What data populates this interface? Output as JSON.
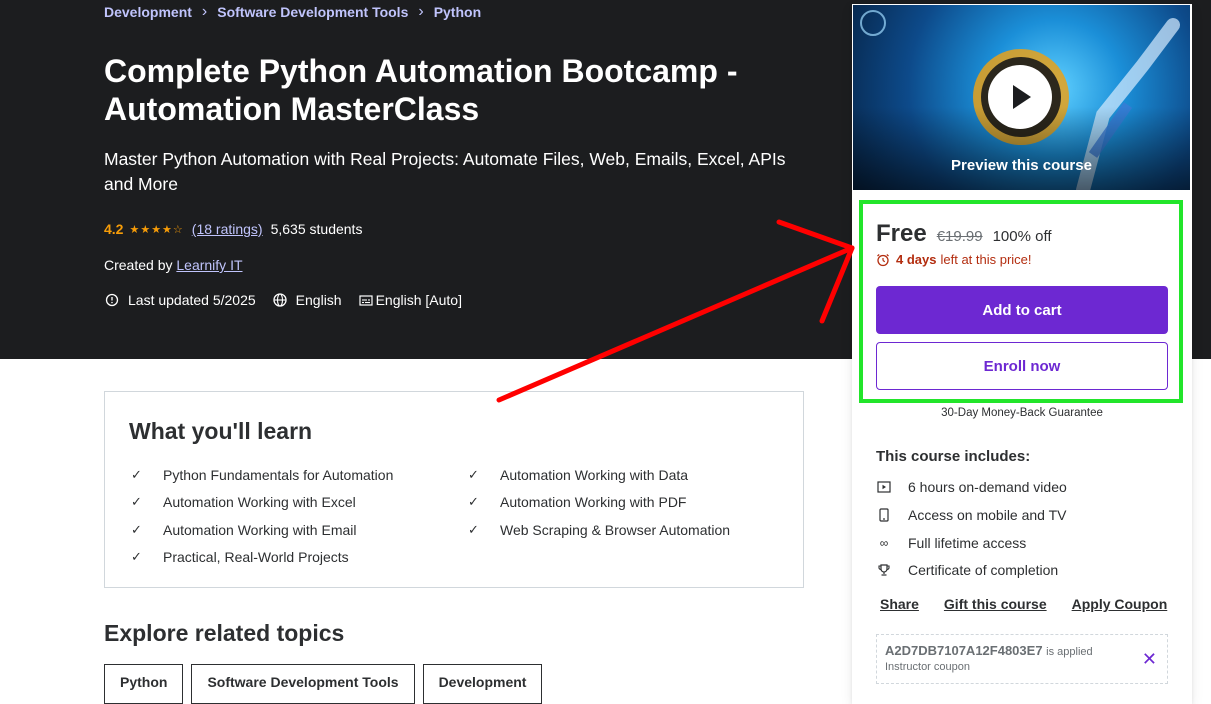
{
  "breadcrumb": [
    "Development",
    "Software Development Tools",
    "Python"
  ],
  "course": {
    "title": "Complete Python Automation Bootcamp - Automation MasterClass",
    "subtitle": "Master Python Automation with Real Projects: Automate Files, Web, Emails, Excel, APIs and More",
    "rating": "4.2",
    "stars": "★★★★☆",
    "ratings_count": "(18 ratings)",
    "students": "5,635 students",
    "created_by_label": "Created by",
    "instructor": "Learnify IT",
    "last_updated": "Last updated 5/2025",
    "language": "English",
    "captions": "English [Auto]"
  },
  "learn": {
    "title": "What you'll learn",
    "items_left": [
      "Python Fundamentals for Automation",
      "Automation Working with Excel",
      "Automation Working with Email",
      "Practical, Real-World Projects"
    ],
    "items_right": [
      "Automation Working with Data",
      "Automation Working with PDF",
      "Web Scraping & Browser Automation"
    ]
  },
  "explore": {
    "title": "Explore related topics",
    "tags": [
      "Python",
      "Software Development Tools",
      "Development"
    ]
  },
  "sidebar": {
    "preview_label": "Preview this course",
    "price": "Free",
    "original_price": "€19.99",
    "discount": "100% off",
    "timer_bold": "4 days",
    "timer_rest": "left at this price!",
    "add_to_cart": "Add to cart",
    "enroll_now": "Enroll now",
    "guarantee": "30-Day Money-Back Guarantee",
    "includes_title": "This course includes:",
    "includes": [
      "6 hours on-demand video",
      "Access on mobile and TV",
      "Full lifetime access",
      "Certificate of completion"
    ],
    "share": "Share",
    "gift": "Gift this course",
    "apply_coupon": "Apply Coupon",
    "coupon_code": "A2D7DB7107A12F4803E7",
    "coupon_applied": "is applied",
    "coupon_label": "Instructor coupon"
  },
  "colors": {
    "hero_bg": "#1c1d1f",
    "accent_purple": "#6d28d2",
    "star_orange": "#f69c08",
    "link_lavender": "#c0c4fc",
    "timer_red": "#b32d0f",
    "highlight_green": "#22e52a",
    "annotation_red": "#ff0000"
  }
}
